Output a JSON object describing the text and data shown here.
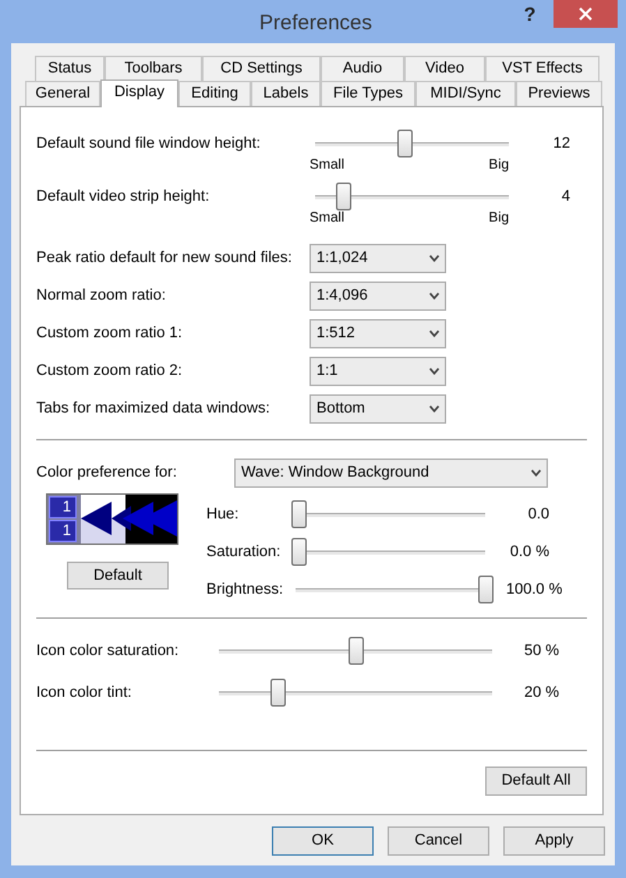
{
  "window": {
    "title": "Preferences",
    "help": "?"
  },
  "tabs": [
    [
      {
        "label": "Status",
        "selected": false
      },
      {
        "label": "Toolbars",
        "selected": false
      },
      {
        "label": "CD Settings",
        "selected": false
      },
      {
        "label": "Audio",
        "selected": false
      },
      {
        "label": "Video",
        "selected": false
      },
      {
        "label": "VST Effects",
        "selected": false
      }
    ],
    [
      {
        "label": "General",
        "selected": false
      },
      {
        "label": "Display",
        "selected": true
      },
      {
        "label": "Editing",
        "selected": false
      },
      {
        "label": "Labels",
        "selected": false
      },
      {
        "label": "File Types",
        "selected": false
      },
      {
        "label": "MIDI/Sync",
        "selected": false
      },
      {
        "label": "Previews",
        "selected": false
      }
    ]
  ],
  "height_sliders": [
    {
      "label": "Default sound file window height:",
      "level": 0.46,
      "reading": "12",
      "min_label": "Small",
      "max_label": "Big"
    },
    {
      "label": "Default video strip height:",
      "level": 0.12,
      "reading": "4",
      "min_label": "Small",
      "max_label": "Big"
    }
  ],
  "dropdowns": [
    {
      "label": "Peak ratio default for new sound files:",
      "value": "1:1,024"
    },
    {
      "label": "Normal zoom ratio:",
      "value": "1:4,096"
    },
    {
      "label": "Custom zoom ratio 1:",
      "value": "1:512"
    },
    {
      "label": "Custom zoom ratio 2:",
      "value": "1:1"
    },
    {
      "label": "Tabs for maximized data windows:",
      "value": "Bottom"
    }
  ],
  "color_preference": {
    "label": "Color preference for:",
    "value": "Wave: Window Background",
    "preview_numbers": [
      "1",
      "1"
    ],
    "default_button": "Default",
    "sliders": [
      {
        "label": "Hue:",
        "level": 0,
        "reading": "0.0"
      },
      {
        "label": "Saturation:",
        "level": 0,
        "reading": "0.0 %"
      },
      {
        "label": "Brightness:",
        "level": 1,
        "reading": "100.0 %"
      }
    ]
  },
  "icon_sliders": [
    {
      "label": "Icon color saturation:",
      "level": 0.5,
      "reading": "50 %"
    },
    {
      "label": "Icon color tint:",
      "level": 0.2,
      "reading": "20 %"
    }
  ],
  "default_all_button": "Default All",
  "buttons": [
    {
      "label": "OK",
      "default": true
    },
    {
      "label": "Cancel",
      "default": false
    },
    {
      "label": "Apply",
      "default": false
    }
  ]
}
